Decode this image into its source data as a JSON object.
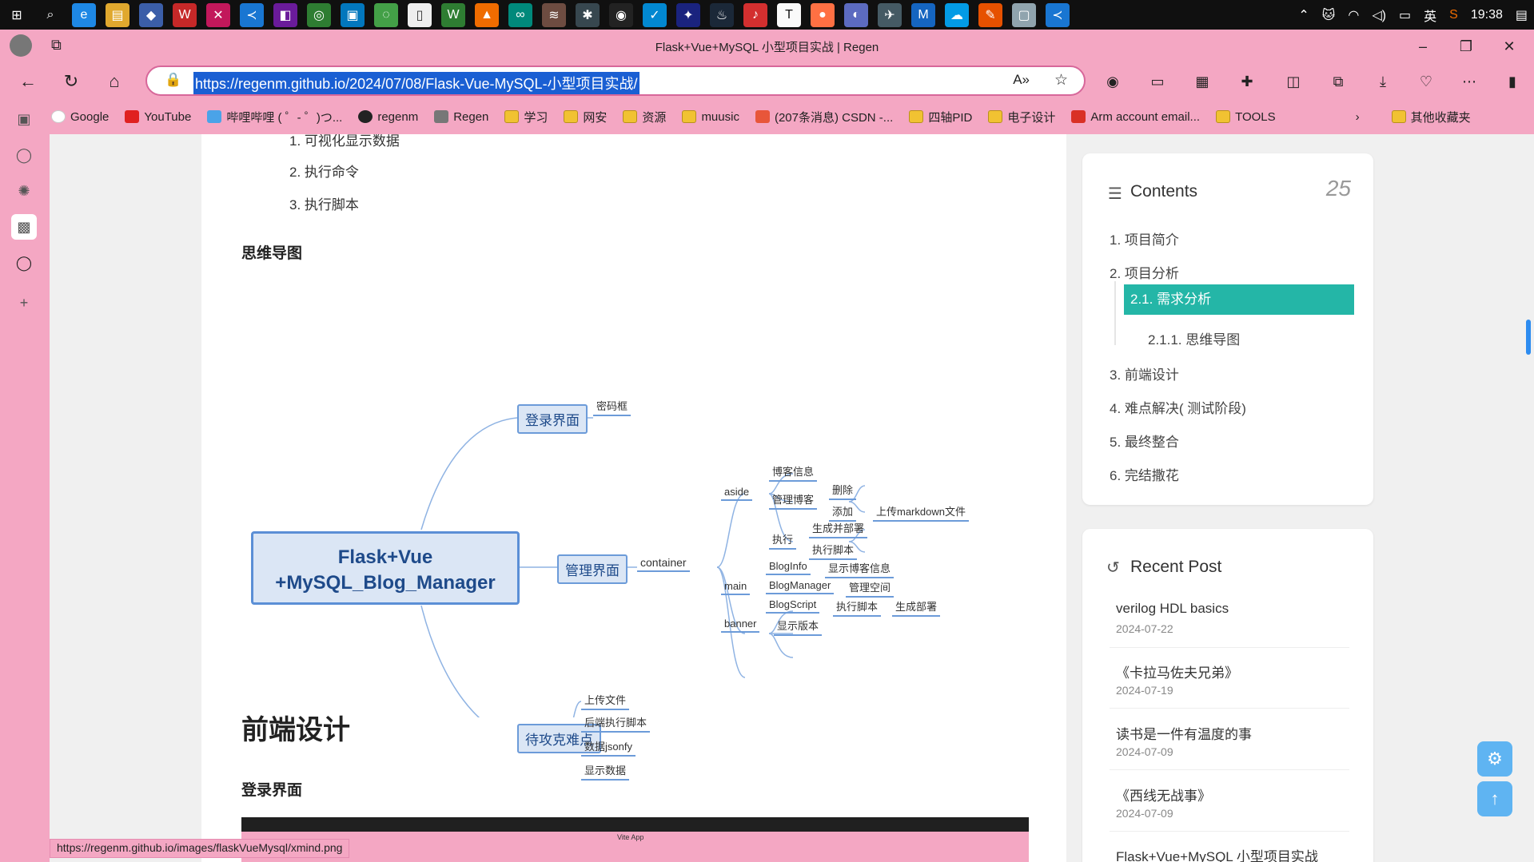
{
  "taskbar": {
    "icons": [
      "windows-icon",
      "search-icon",
      "edge-icon",
      "explorer-icon",
      "app-icon",
      "wps-icon",
      "xmind-icon",
      "vscode-icon",
      "app-icon",
      "app-icon",
      "app-icon",
      "wechat-icon",
      "notepad-icon",
      "app-icon",
      "app-icon",
      "app-icon",
      "app-icon",
      "app-icon",
      "app-icon",
      "app-icon",
      "app-icon",
      "steam-icon",
      "netease-icon",
      "typora-icon",
      "app-icon",
      "app-icon",
      "app-icon",
      "mx-icon",
      "app-icon",
      "app-icon",
      "app-icon",
      "vscode-icon"
    ],
    "lang": "英",
    "time": "19:38"
  },
  "window": {
    "title": "Flask+Vue+MySQL 小型项目实战 | Regen"
  },
  "address": {
    "url": "https://regenm.github.io/2024/07/08/Flask-Vue-MySQL-小型项目实战/"
  },
  "bookmarks": [
    {
      "label": "Google",
      "color": "#ffffff"
    },
    {
      "label": "YouTube",
      "color": "#e02020"
    },
    {
      "label": "哔哩哔哩 ( ゜- ゜)つ...",
      "color": "#4aa3e8"
    },
    {
      "label": "regenm",
      "color": "#222222"
    },
    {
      "label": "Regen",
      "color": "#777777"
    },
    {
      "label": "学习",
      "color": "folder"
    },
    {
      "label": "网安",
      "color": "folder"
    },
    {
      "label": "资源",
      "color": "folder"
    },
    {
      "label": "muusic",
      "color": "folder"
    },
    {
      "label": "(207条消息) CSDN -...",
      "color": "#e8563a"
    },
    {
      "label": "四轴PID",
      "color": "folder"
    },
    {
      "label": "电子设计",
      "color": "folder"
    },
    {
      "label": "Arm account email...",
      "color": "#d93025"
    },
    {
      "label": "TOOLS",
      "color": "folder"
    }
  ],
  "bookmarks_other": "其他收藏夹",
  "article": {
    "list_item_1": "1. 可视化显示数据",
    "list_item_2": "2. 执行命令",
    "list_item_3": "3. 执行脚本",
    "heading_mindmap": "思维导图",
    "heading_frontend": "前端设计",
    "heading_login": "登录界面"
  },
  "mindmap": {
    "root_line1": "Flask+Vue",
    "root_line2": "+MySQL_Blog_Manager",
    "login": "登录界面",
    "login_child": "密码框",
    "manage": "管理界面",
    "container": "container",
    "aside": "aside",
    "blog_info": "博客信息",
    "manage_blog": "管理博客",
    "delete": "删除",
    "add": "添加",
    "upload_md": "上传markdown文件",
    "execute": "执行",
    "gen_deploy": "生成并部署",
    "exec_script": "执行脚本",
    "main": "main",
    "bloginfo": "BlogInfo",
    "show_blog_info": "显示博客信息",
    "blogmanager": "BlogManager",
    "manage_space": "管理空间",
    "blogscript": "BlogScript",
    "exec_script2": "执行脚本",
    "gen_deploy2": "生成部署",
    "banner": "banner",
    "show_version": "显示版本",
    "todo": "待攻克难点",
    "upload_file": "上传文件",
    "backend_script": "后端执行脚本",
    "data_json": "数据jsonfy",
    "show_data": "显示数据"
  },
  "contents": {
    "title": "Contents",
    "count": "25",
    "items": [
      "1. 项目简介",
      "2. 项目分析",
      "2.1. 需求分析",
      "2.1.1. 思维导图",
      "3. 前端设计",
      "4. 难点解决( 测试阶段)",
      "5. 最终整合",
      "6. 完结撒花"
    ]
  },
  "recent": {
    "title": "Recent Post",
    "posts": [
      {
        "title": "verilog HDL basics",
        "date": "2024-07-22"
      },
      {
        "title": "《卡拉马佐夫兄弟》",
        "date": "2024-07-19"
      },
      {
        "title": "读书是一件有温度的事",
        "date": "2024-07-09"
      },
      {
        "title": "《西线无战事》",
        "date": "2024-07-09"
      },
      {
        "title": "Flask+Vue+MySQL 小型项目实战",
        "date": ""
      }
    ]
  },
  "statusbar": {
    "link": "https://regenm.github.io/images/flaskVueMysql/xmind.png"
  },
  "screenshot_strip": {
    "tab_title": "Vite App"
  },
  "theme": {
    "accent": "#24b6a7",
    "chrome_pink": "#f4a7c3",
    "mind_blue": "#5b8fd6"
  }
}
